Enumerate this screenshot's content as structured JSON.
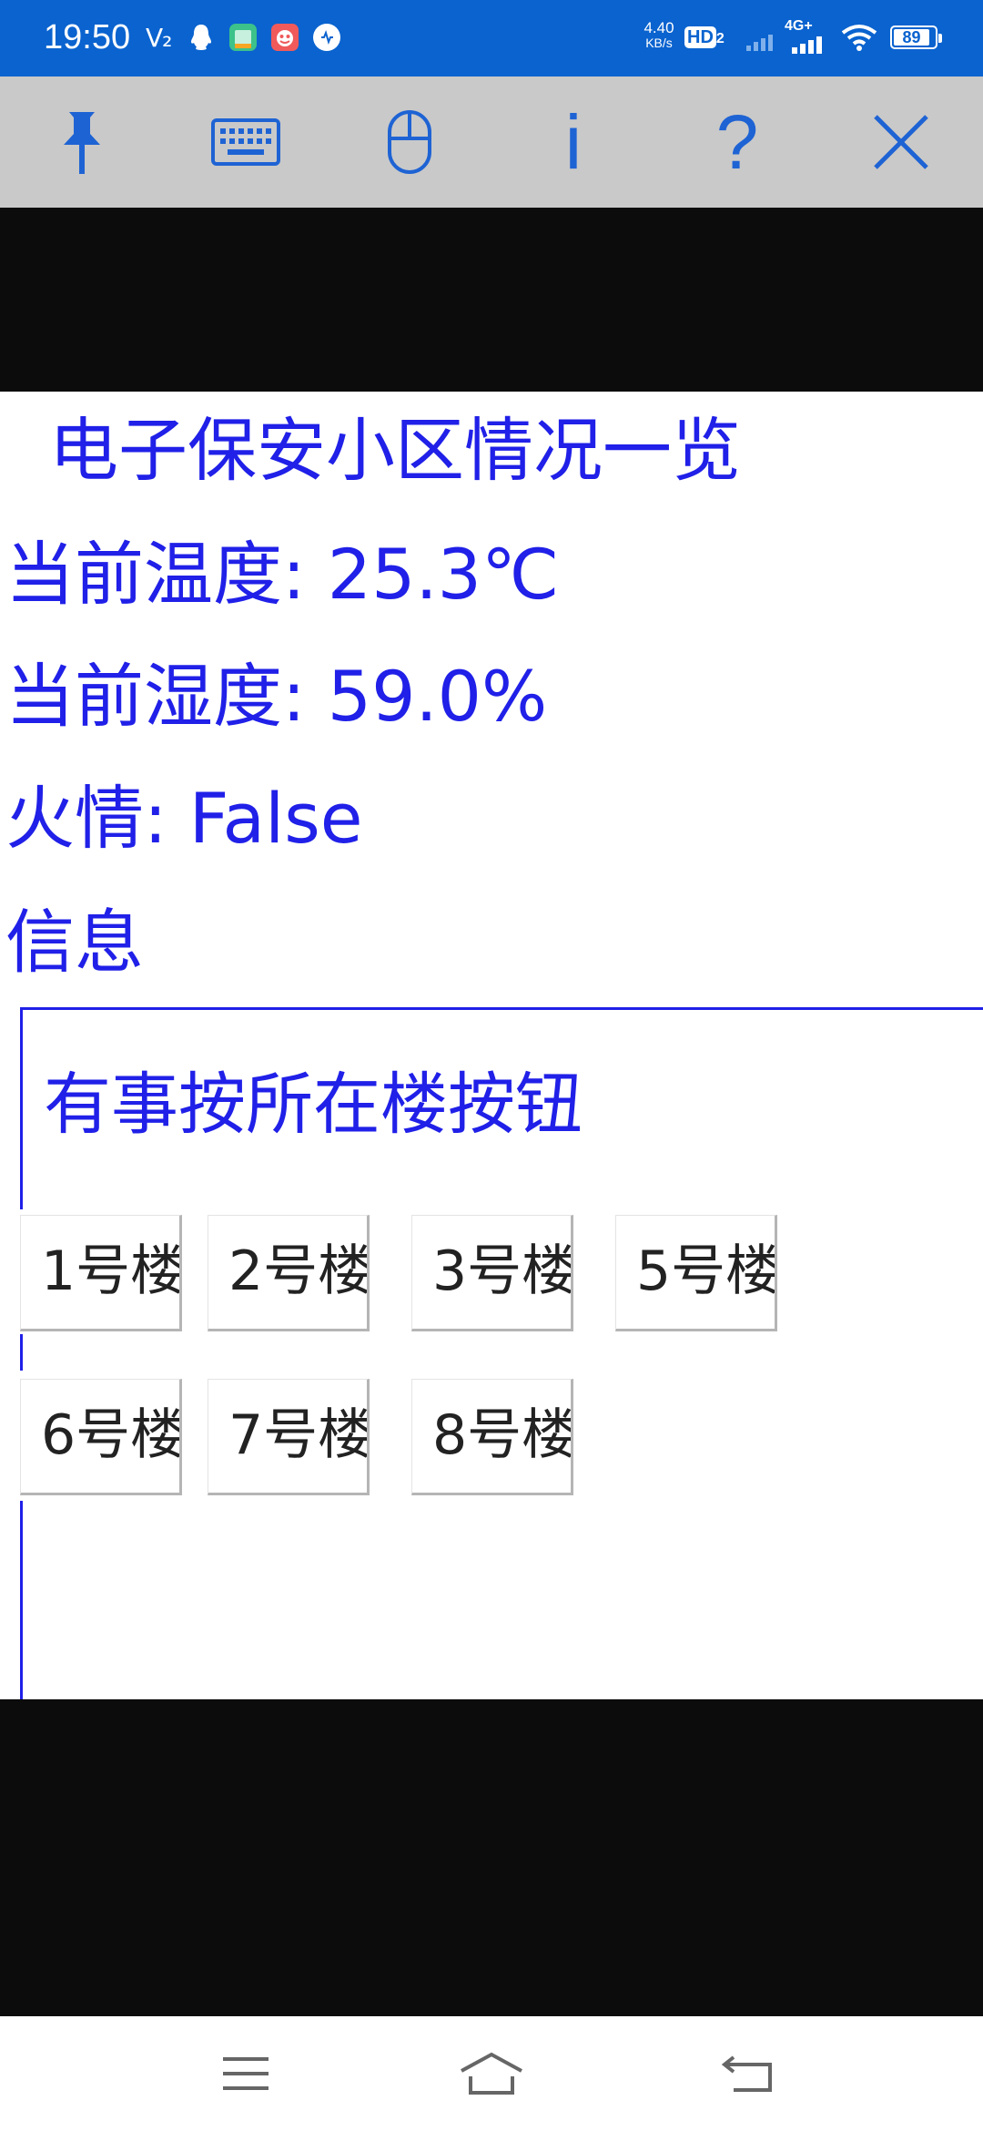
{
  "status_bar": {
    "time": "19:50",
    "carrier_mark": "V₂",
    "net_speed_value": "4.40",
    "net_speed_unit": "KB/s",
    "hd_label": "HD",
    "hd_sub": "2",
    "network_type": "4G+",
    "battery_level": "89",
    "icons": [
      "qq-icon",
      "app-icon-green",
      "app-icon-red",
      "app-icon-chat",
      "signal-icon",
      "wifi-icon",
      "battery-icon"
    ]
  },
  "toolbar": {
    "items": [
      {
        "name": "pin-icon",
        "glyph": ""
      },
      {
        "name": "keyboard-icon",
        "glyph": ""
      },
      {
        "name": "mouse-icon",
        "glyph": ""
      },
      {
        "name": "info-button",
        "glyph": "i"
      },
      {
        "name": "help-button",
        "glyph": "?"
      },
      {
        "name": "close-icon",
        "glyph": ""
      }
    ],
    "accent_color": "#1e63d4",
    "background_color": "#c9c9c9"
  },
  "content": {
    "title": "电子保安小区情况一览",
    "temperature_text": "当前温度: 25.3℃",
    "humidity_text": "当前湿度: 59.0%",
    "fire_text": "火情: False",
    "info_label": "信息",
    "panel_caption": "有事按所在楼按钮",
    "text_color": "#2020e8",
    "building_buttons": [
      {
        "label": "1号楼"
      },
      {
        "label": "2号楼"
      },
      {
        "label": "3号楼"
      },
      {
        "label": "5号楼"
      },
      {
        "label": "6号楼"
      },
      {
        "label": "7号楼"
      },
      {
        "label": "8号楼"
      }
    ]
  },
  "nav_bar": {
    "buttons": [
      "menu-icon",
      "home-icon",
      "back-icon"
    ]
  }
}
